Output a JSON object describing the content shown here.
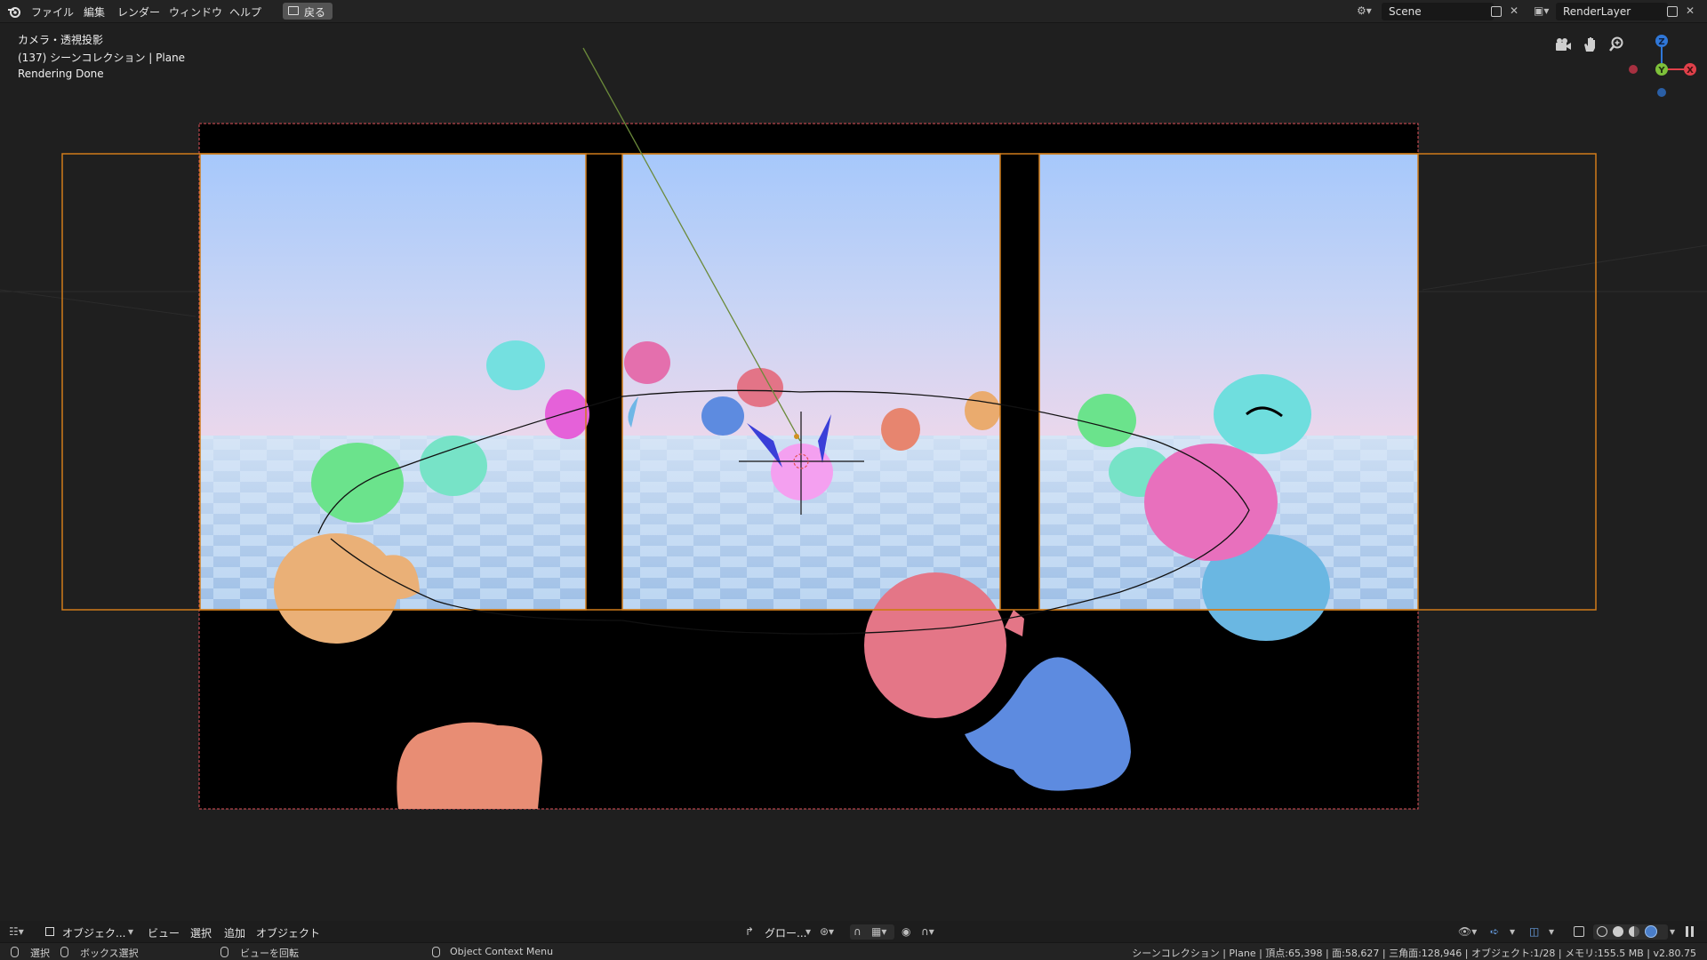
{
  "menubar": {
    "items": [
      "ファイル",
      "編集",
      "レンダー",
      "ウィンドウ",
      "ヘルプ"
    ],
    "back_label": "戻る",
    "scene_name": "Scene",
    "view_layer": "RenderLayer"
  },
  "viewport_overlay": {
    "view_name": "カメラ・透視投影",
    "collection_info": "(137) シーンコレクション | Plane",
    "render_status": "Rendering Done"
  },
  "gizmo": {
    "z": "Z",
    "y": "Y",
    "x": "X"
  },
  "bottom_header": {
    "mode": "オブジェク...",
    "menus": [
      "ビュー",
      "選択",
      "追加",
      "オブジェクト"
    ],
    "transform_orientation": "グロー..."
  },
  "statusbar": {
    "select": "選択",
    "box_select": "ボックス選択",
    "rotate_view": "ビューを回転",
    "context_menu": "Object Context Menu",
    "stats": "シーンコレクション | Plane | 頂点:65,398 | 面:58,627 | 三角面:128,946 | オブジェクト:1/28 | メモリ:155.5 MB | v2.80.75"
  },
  "colors": {
    "accent_orange": "#d07c1a",
    "camera_border": "#e0525a",
    "ui_bg": "#1d1d1d",
    "header_bg": "#232323",
    "button": "#545454"
  },
  "icons": [
    "blender-logo-icon",
    "back-icon",
    "scene-icon",
    "view-layer-icon",
    "copy-icon",
    "close-icon",
    "camera-icon",
    "hand-icon",
    "zoom-icon",
    "axis-gizmo",
    "editor-type-icon",
    "object-mode-icon",
    "orientation-icon",
    "pivot-icon",
    "snap-icon",
    "proportional-icon",
    "visibility-icon",
    "gizmo-icon",
    "overlay-icon",
    "xray-icon",
    "shading-wireframe-icon",
    "shading-solid-icon",
    "shading-material-icon",
    "shading-rendered-icon",
    "mouse-left-icon",
    "mouse-middle-icon",
    "mouse-right-icon"
  ]
}
